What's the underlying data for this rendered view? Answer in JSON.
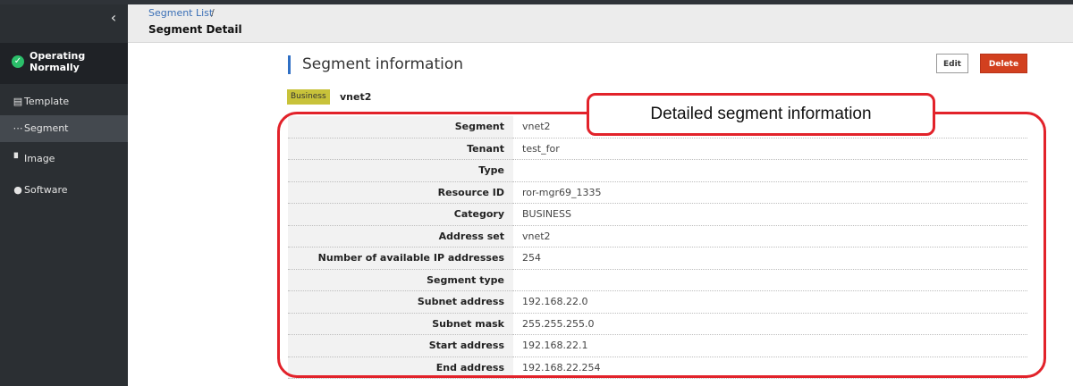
{
  "breadcrumb": {
    "parent": "Segment List",
    "separator": "/",
    "current": "Segment Detail"
  },
  "sidebar": {
    "collapse_icon": "‹",
    "status": {
      "icon": "check-circle-icon",
      "label": "Operating Normally"
    },
    "items": [
      {
        "label": "Template",
        "icon": "template-icon"
      },
      {
        "label": "Segment",
        "icon": "segment-icon",
        "active": true
      },
      {
        "label": "Image",
        "icon": "image-icon"
      },
      {
        "label": "Software",
        "icon": "software-icon"
      }
    ]
  },
  "main": {
    "section_title": "Segment information",
    "edit_label": "Edit",
    "delete_label": "Delete",
    "badge": "Business",
    "segment_name": "vnet2",
    "rows": [
      {
        "key": "Segment",
        "value": "vnet2"
      },
      {
        "key": "Tenant",
        "value": "test_for"
      },
      {
        "key": "Type",
        "value": ""
      },
      {
        "key": "Resource ID",
        "value": "ror-mgr69_1335"
      },
      {
        "key": "Category",
        "value": "BUSINESS"
      },
      {
        "key": "Address set",
        "value": "vnet2"
      },
      {
        "key": "Number of available IP addresses",
        "value": "254"
      },
      {
        "key": "Segment type",
        "value": ""
      },
      {
        "key": "Subnet address",
        "value": "192.168.22.0"
      },
      {
        "key": "Subnet mask",
        "value": "255.255.255.0"
      },
      {
        "key": "Start address",
        "value": "192.168.22.1"
      },
      {
        "key": "End address",
        "value": "192.168.22.254"
      }
    ]
  },
  "callout": {
    "label": "Detailed segment information"
  },
  "colors": {
    "accent": "#2f6fc4",
    "delete": "#d2401f",
    "callout": "#e2222a",
    "status_ok": "#2bbf6a",
    "badge": "#c8c23a"
  }
}
